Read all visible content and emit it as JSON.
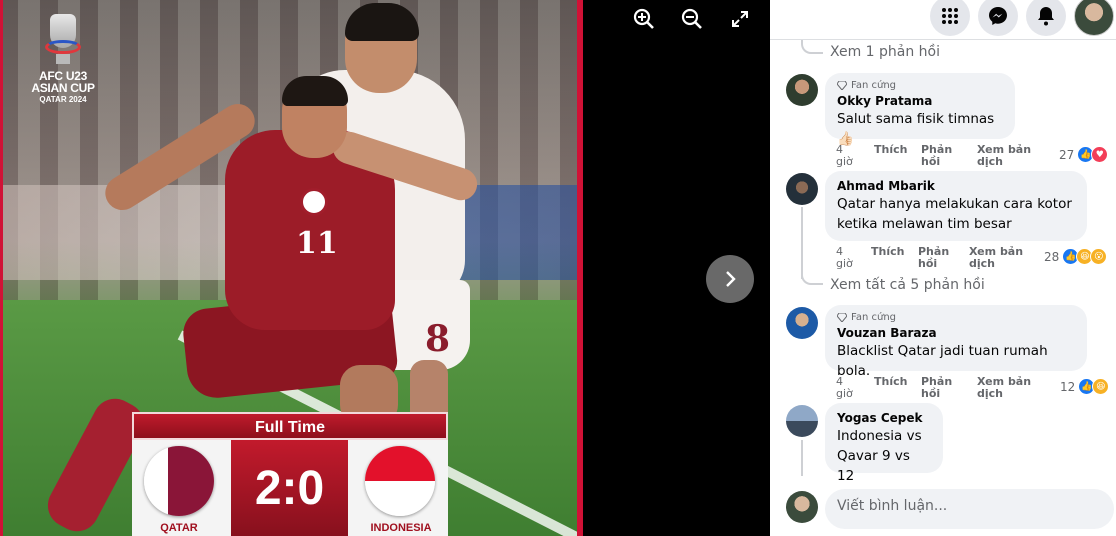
{
  "photo": {
    "logo_line1": "AFC U23",
    "logo_line2": "ASIAN CUP",
    "logo_line3": "QATAR 2024",
    "jersey_red_number": "11",
    "jersey_white_number": "8",
    "scoreboard": {
      "status": "Full Time",
      "score": "2:0",
      "home_team": "QATAR",
      "away_team": "INDONESIA"
    }
  },
  "viewer_controls": {
    "zoom_in_icon": "zoom-in-icon",
    "zoom_out_icon": "zoom-out-icon",
    "fullscreen_icon": "fullscreen-icon",
    "next_icon": "chevron-right-icon"
  },
  "topbar": {
    "menu_icon": "grid-menu-icon",
    "messenger_icon": "messenger-icon",
    "notifications_icon": "bell-icon"
  },
  "comments": {
    "view_reply_top": "Xem 1 phản hồi",
    "items": [
      {
        "badge": "Fan cứng",
        "name": "Okky Pratama",
        "text": "Salut sama fisik timnas👍🏻",
        "time": "4 giờ",
        "like": "Thích",
        "reply": "Phản hồi",
        "translate": "Xem bản dịch",
        "reaction_count": "27"
      },
      {
        "badge": "",
        "name": "Ahmad Mbarik",
        "text": "Qatar hanya melakukan cara kotor ketika melawan tim besar",
        "time": "4 giờ",
        "like": "Thích",
        "reply": "Phản hồi",
        "translate": "Xem bản dịch",
        "reaction_count": "28",
        "view_replies": "Xem tất cả 5 phản hồi"
      },
      {
        "badge": "Fan cứng",
        "name": "Vouzan Baraza",
        "text": "Blacklist Qatar jadi tuan rumah bola.",
        "time": "4 giờ",
        "like": "Thích",
        "reply": "Phản hồi",
        "translate": "Xem bản dịch",
        "reaction_count": "12"
      },
      {
        "badge": "",
        "name": "Yogas Cepek",
        "text": "Indonesia vs Qavar 9 vs 12"
      }
    ]
  },
  "composer": {
    "placeholder": "Viết bình luận..."
  },
  "colors": {
    "qatar_maroon": "#8a1538",
    "scoreboard_red": "#c01b2c",
    "facebook_blue": "#1877f2",
    "bubble_gray": "#f0f2f5"
  }
}
